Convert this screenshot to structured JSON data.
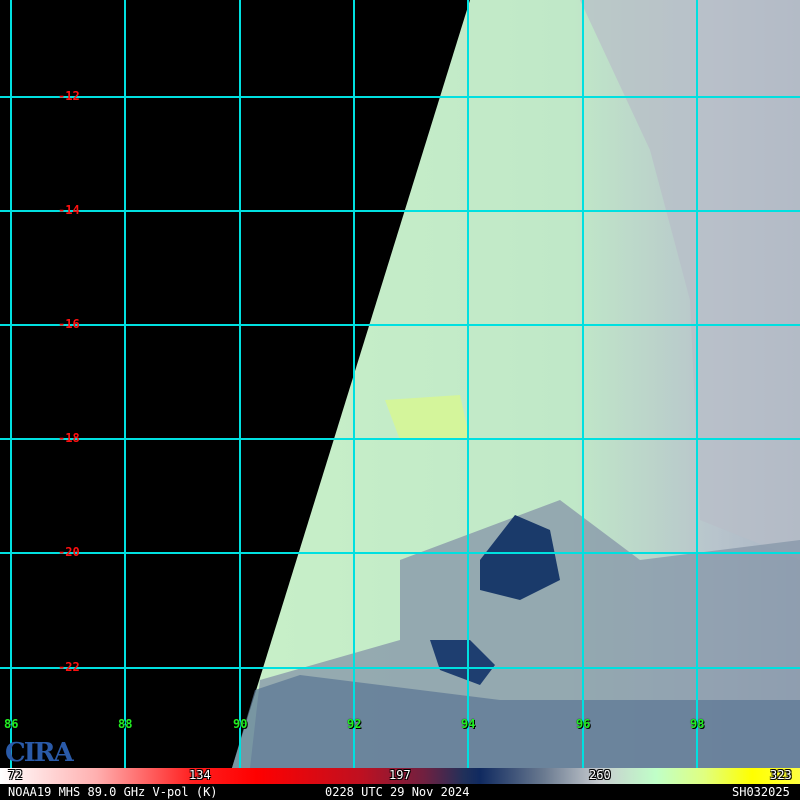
{
  "image": {
    "lat_labels": [
      "-12",
      "-14",
      "-16",
      "-18",
      "-20",
      "-22"
    ],
    "lon_labels": [
      "86",
      "88",
      "90",
      "92",
      "94",
      "96",
      "98"
    ],
    "logo_text": "CIRA"
  },
  "colorbar": {
    "ticks": [
      "72",
      "134",
      "197",
      "260",
      "323"
    ]
  },
  "footer": {
    "product": "NOAA19 MHS 89.0 GHz V-pol (K)",
    "time": "0228 UTC 29 Nov 2024",
    "storm_id": "SH032025"
  },
  "colors": {
    "grid": "#00e0e0",
    "lat_label": "#ff1010",
    "lon_label": "#22ee22"
  }
}
